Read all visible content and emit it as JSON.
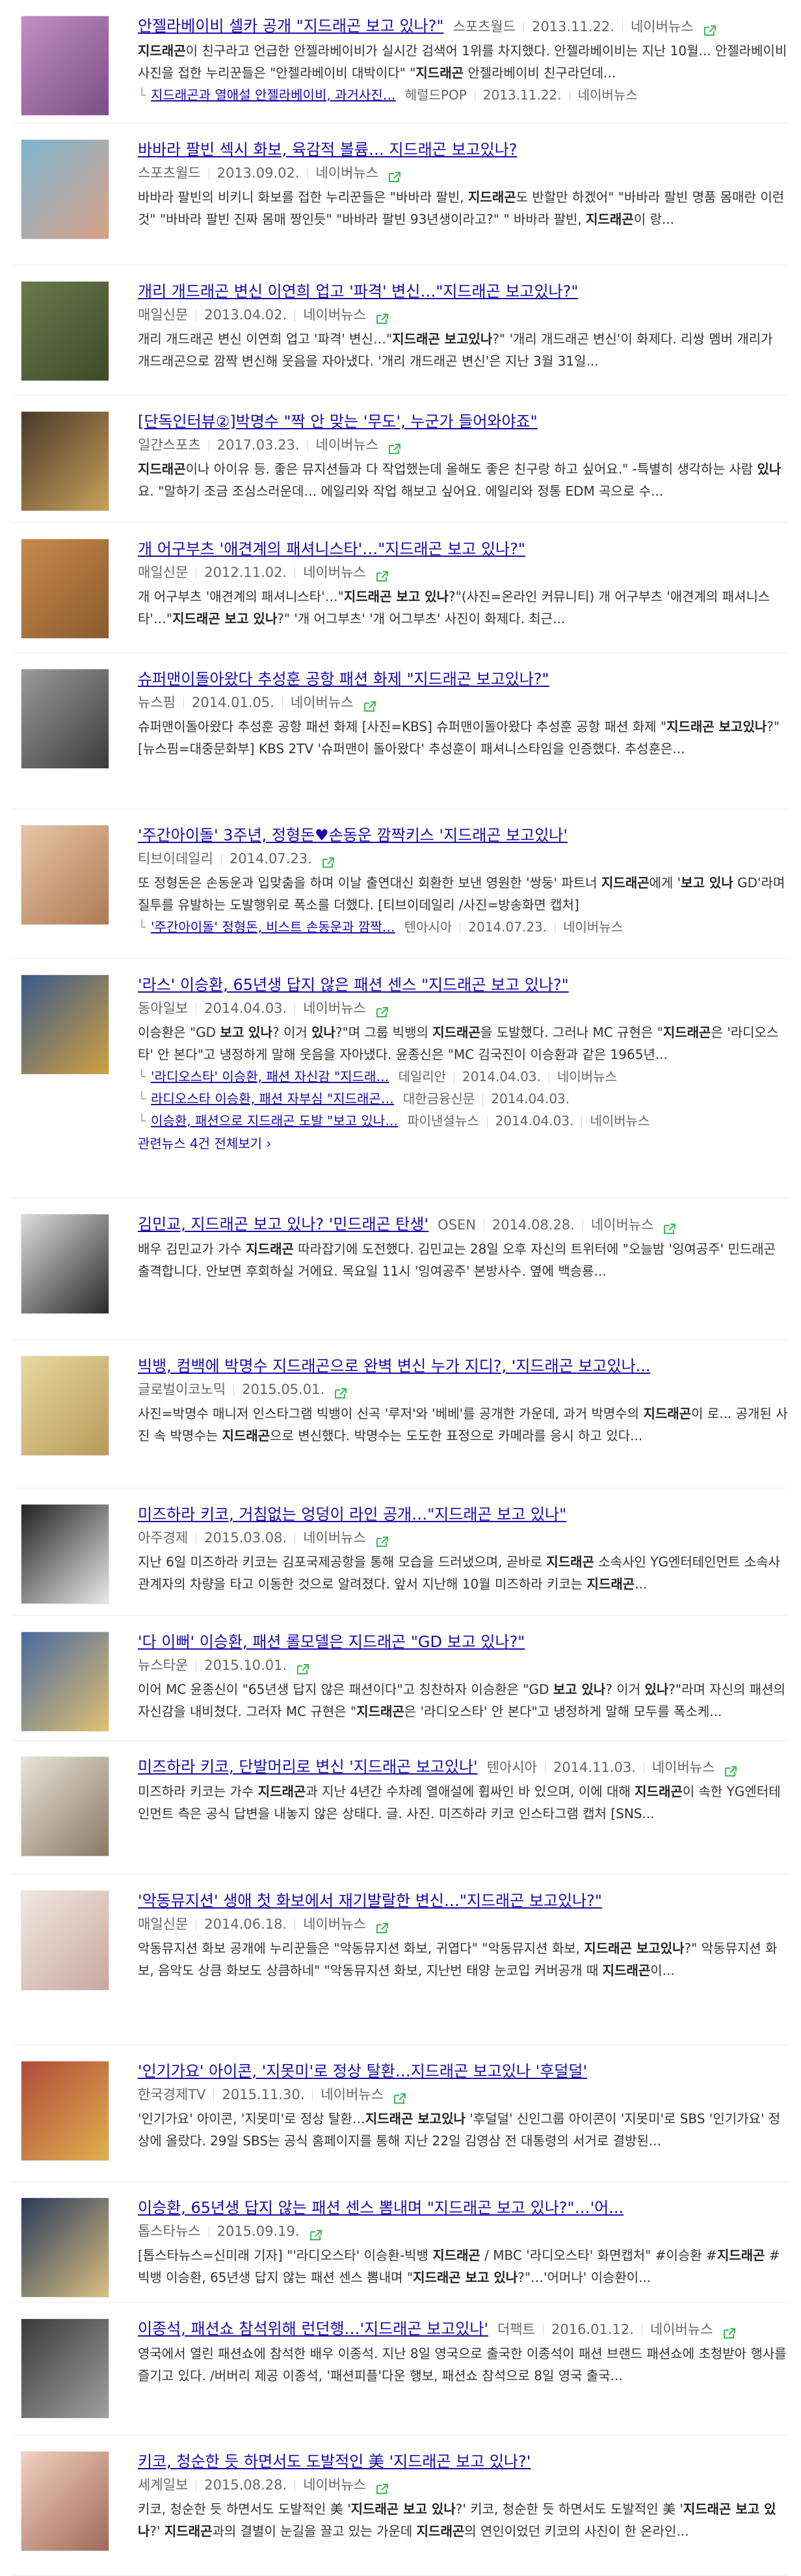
{
  "accent": "#1a0dab",
  "icon": "external-link-icon",
  "items": [
    {
      "title": "안젤라베이비 셀카 공개 \"지드래곤 보고 있나?\"",
      "source": "스포츠월드",
      "date": "2013.11.22.",
      "portal": "네이버뉴스",
      "snippet": "지드래곤이 친구라고 언급한 안젤라베이비가 실시간 검색어 1위를 차지했다. 안젤라베이비는 지난 10월... 안젤라베이비 사진을 접한 누리꾼들은 \"안젤라베이비 대박이다\" \"지드래곤 안젤라베이비 친구라던데...",
      "related": [
        {
          "title": "지드래곤과 열애설 안젤라베이비, 과거사진…",
          "source": "헤럴드POP",
          "date": "2013.11.22.",
          "portal": "네이버뉴스"
        }
      ],
      "thumb": [
        "#c28fc4",
        "#7c4d86"
      ]
    },
    {
      "title": "바바라 팔빈 섹시 화보, 육감적 볼륨… 지드래곤 보고있나?",
      "source": "스포츠월드",
      "date": "2013.09.02.",
      "portal": "네이버뉴스",
      "snippet": "바바라 팔빈의 비키니 화보를 접한 누리꾼들은 \"바바라 팔빈, 지드래곤도 반할만 하겠어\" \"바바라 팔빈 명품 몸매란 이런 것\" \"바바라 팔빈 진짜 몸매 짱인듯\" \"바바라 팔빈 93년생이라고?\" \" 바바라 팔빈, 지드래곤이 랑...",
      "related": [],
      "thumb": [
        "#7fb6d2",
        "#d9a087"
      ]
    },
    {
      "title": "개리 개드래곤 변신 이연희 업고 '파격' 변신…\"지드래곤 보고있나?\"",
      "source": "매일신문",
      "date": "2013.04.02.",
      "portal": "네이버뉴스",
      "snippet": "개리 개드래곤 변신 이연희 업고 '파격' 변신…\"지드래곤 보고있나?\" '개리 개드래곤 변신'이 화제다. 리쌍 멤버 개리가 개드래곤으로 깜짝 변신해 웃음을 자아냈다. '개리 개드래곤 변신'은 지난 3월 31일...",
      "related": [],
      "thumb": [
        "#6b7a4a",
        "#3d4a2c"
      ]
    },
    {
      "title": "[단독인터뷰②]박명수 \"짝 안 맞는 '무도', 누군가 들어와야죠\"",
      "source": "일간스포츠",
      "date": "2017.03.23.",
      "portal": "네이버뉴스",
      "snippet": "지드래곤이나 아이유 등. 좋은 뮤지션들과 다 작업했는데 올해도 좋은 친구랑 하고 싶어요.\" -특별히 생각하는 사람 있나요. \"말하기 조금 조심스러운데… 에일리와 작업 해보고 싶어요. 에일리와 정통 EDM 곡으로 수...",
      "related": [],
      "thumb": [
        "#4a3a2a",
        "#c9a15a"
      ]
    },
    {
      "title": "개 어구부츠 '애견계의 패셔니스타'…\"지드래곤 보고 있나?\"",
      "source": "매일신문",
      "date": "2012.11.02.",
      "portal": "네이버뉴스",
      "snippet": "개 어구부츠 '애견계의 패셔니스타'…\"지드래곤 보고 있나?\"(사진=온라인 커뮤니티) 개 어구부츠 '애견계의 패셔니스타'…\"지드래곤 보고 있나?\" '개 어그부츠' '개 어그부츠' 사진이 화제다. 최근...",
      "related": [],
      "thumb": [
        "#c98a4b",
        "#8a5a2e"
      ]
    },
    {
      "title": "슈퍼맨이돌아왔다 추성훈 공항 패션 화제 \"지드래곤 보고있나?\"",
      "source": "뉴스핌",
      "date": "2014.01.05.",
      "portal": "네이버뉴스",
      "snippet": "슈퍼맨이돌아왔다 추성훈 공항 패션 화제 [사진=KBS] 슈퍼맨이돌아왔다 추성훈 공항 패션 화제 \"지드래곤 보고있나?\" [뉴스핌=대중문화부] KBS 2TV '슈퍼맨이 돌아왔다' 추성훈이 패셔니스타임을 인증했다. 추성훈은...",
      "related": [],
      "thumb": [
        "#9a9a9a",
        "#3c3c3c"
      ]
    },
    {
      "title": "'주간아이돌' 3주년, 정형돈♥손동운 깜짝키스 '지드래곤 보고있나'",
      "source": "티브이데일리",
      "date": "2014.07.23.",
      "portal": "",
      "snippet": "또 정형돈은 손동운과 입맞춤을 하며 이날 출연대신 회환한 보낸 영원한 '쌍둥' 파트너 지드래곤에게 '보고 있나 GD'라며 질투를 유발하는 도발행위로 폭소를 더했다. [티브이데일리 /사진=방송화면 캡처]",
      "related": [
        {
          "title": "'주간아이돌' 정형돈, 비스트 손동운과 깜짝…",
          "source": "텐아시아",
          "date": "2014.07.23.",
          "portal": "네이버뉴스"
        }
      ],
      "thumb": [
        "#e7c6a6",
        "#b07a55"
      ]
    },
    {
      "title": "'라스' 이승환, 65년생 답지 않은 패션 센스 \"지드래곤 보고 있나?\"",
      "source": "동아일보",
      "date": "2014.04.03.",
      "portal": "네이버뉴스",
      "snippet": "이승환은 \"GD 보고 있나? 이거 있나?\"며 그룹 빅뱅의 지드래곤을 도발했다. 그러나 MC 규현은 \"지드래곤은 '라디오스타' 안 본다\"고 냉정하게 말해 웃음을 자아냈다. 윤종신은 \"MC 김국진이 이승환과 같은 1965년...",
      "related": [
        {
          "title": "'라디오스타' 이승환, 패션 자신감 \"지드래…",
          "source": "데일리안",
          "date": "2014.04.03.",
          "portal": "네이버뉴스"
        },
        {
          "title": "라디오스타 이승환, 패션 자부심 \"지드래곤…",
          "source": "대한금융신문",
          "date": "2014.04.03.",
          "portal": ""
        },
        {
          "title": "이승환, 패션으로 지드래곤 도발 \"보고 있나…",
          "source": "파이낸셜뉴스",
          "date": "2014.04.03.",
          "portal": "네이버뉴스"
        }
      ],
      "more": "관련뉴스 4건 전체보기",
      "thumb": [
        "#3a5a8a",
        "#d0a040"
      ]
    },
    {
      "title": "김민교, 지드래곤 보고 있나? '민드래곤 탄생'",
      "source": "OSEN",
      "date": "2014.08.28.",
      "portal": "네이버뉴스",
      "snippet": "배우 김민교가 가수 지드래곤 따라잡기에 도전했다. 김민교는 28일 오후 자신의 트위터에 \"오늘밤 '잉여공주' 민드래곤 출격합니다. 안보면 후회하실 거에요. 목요일 11시 '잉여공주' 본방사수. 옆에 백승룡...",
      "related": [],
      "thumb": [
        "#dcdcdc",
        "#2a2a2a"
      ]
    },
    {
      "title": "빅뱅, 컴백에 박명수 지드래곤으로 완벽 변신 누가 지디?, '지드래곤 보고있나...",
      "source": "글로벌이코노믹",
      "date": "2015.05.01.",
      "portal": "",
      "snippet": "사진=박명수 매니저 인스타그램 빅뱅이 신곡 '루저'와 '베베'를 공개한 가운데, 과거 박명수의 지드래곤이 로... 공개된 사진 속 박명수는 지드래곤으로 변신했다. 박명수는 도도한 표정으로 카메라를 응시 하고 있다...",
      "related": [],
      "thumb": [
        "#e8d9a0",
        "#b89a5a"
      ]
    },
    {
      "title": "미즈하라 키코, 거침없는 엉덩이 라인 공개…\"지드래곤 보고 있나\"",
      "source": "아주경제",
      "date": "2015.03.08.",
      "portal": "네이버뉴스",
      "snippet": "지난 6일 미즈하라 키코는 김포국제공항을 통해 모습을 드러냈으며, 곧바로 지드래곤 소속사인 YG엔터테인먼트 소속사 관계자의 차량을 타고 이동한 것으로 알려졌다. 앞서 지난해 10월 미즈하라 키코는 지드래곤...",
      "related": [],
      "thumb": [
        "#222222",
        "#e9e9e9"
      ]
    },
    {
      "title": "'다 이뻐' 이승환, 패션 롤모델은 지드래곤 \"GD 보고 있나?\"",
      "source": "뉴스타운",
      "date": "2015.10.01.",
      "portal": "",
      "snippet": "이어 MC 윤종신이 \"65년생 답지 않은 패션이다\"고 칭찬하자 이승환은 \"GD 보고 있나? 이거 있나?\"라며 자신의 패션의 자신감을 내비쳤다. 그러자 MC 규현은 \"지드래곤은 '라디오스타' 안 본다\"고 냉정하게 말해 모두를 폭소케...",
      "related": [],
      "thumb": [
        "#4a6aa0",
        "#e0c070"
      ]
    },
    {
      "title": "미즈하라 키코, 단발머리로 변신 '지드래곤 보고있나'",
      "source": "텐아시아",
      "date": "2014.11.03.",
      "portal": "네이버뉴스",
      "snippet": "미즈하라 키코는 가수 지드래곤과 지난 4년간 수차례 열애설에 휩싸인 바 있으며, 이에 대해 지드래곤이 속한 YG엔터테인먼트 측은 공식 답변을 내놓지 않은 상태다. 글. 사진. 미즈하라 키코 인스타그램 캡처 [SNS...",
      "related": [],
      "thumb": [
        "#e9e2d6",
        "#8a7a66"
      ]
    },
    {
      "title": "'악동뮤지션' 생애 첫 화보에서 재기발랄한 변신…\"지드래곤 보고있나?\"",
      "source": "매일신문",
      "date": "2014.06.18.",
      "portal": "네이버뉴스",
      "snippet": "악동뮤지션 화보 공개에 누리꾼들은 \"악동뮤지션 화보, 귀엽다\" \"악동뮤지션 화보, 지드래곤 보고있나?\" 악동뮤지션 화보, 음악도 상큼 화보도 상큼하네\" \"악동뮤지션 화보, 지난번 태양 눈코입 커버공개 때 지드래곤이...",
      "related": [],
      "thumb": [
        "#f0e8e0",
        "#c8a8a0"
      ]
    },
    {
      "title": "'인기가요' 아이콘, '지못미'로 정상 탈환…지드래곤 보고있나 '후덜덜'",
      "source": "한국경제TV",
      "date": "2015.11.30.",
      "portal": "네이버뉴스",
      "snippet": "'인기가요' 아이콘, '지못미'로 정상 탈환…지드래곤 보고있나 '후덜덜' 신인그룹 아이콘이 '지못미'로 SBS '인기가요' 정상에 올랐다. 29일 SBS는 공식 홈페이지를 통해 지난 22일 김영삼 전 대통령의 서거로 결방된...",
      "related": [],
      "thumb": [
        "#b04a3a",
        "#e0b050"
      ]
    },
    {
      "title": "이승환, 65년생 답지 않는 패션 센스 뽐내며 \"지드래곤 보고 있나?\"…'어...",
      "source": "톱스타뉴스",
      "date": "2015.09.19.",
      "portal": "",
      "snippet": "[톱스타뉴스=신미래 기자] \"'라디오스타' 이승환-빅뱅 지드래곤 / MBC '라디오스타' 화면캡처\" #이승환 #지드래곤 #빅뱅 이승환, 65년생 답지 않는 패션 센스 뽐내며 \"지드래곤 보고 있나?\"…'어머나' 이승환이...",
      "related": [],
      "thumb": [
        "#2a3a5a",
        "#d8c080"
      ]
    },
    {
      "title": "이종석, 패션쇼 참석위해 런던행…'지드래곤 보고있나'",
      "source": "더팩트",
      "date": "2016.01.12.",
      "portal": "네이버뉴스",
      "snippet": "영국에서 열린 패션쇼에 참석한 배우 이종석. 지난 8일 영국으로 출국한 이종석이 패션 브랜드 패션쇼에 초청받아 행사를 즐기고 있다. /버버리 제공 이종석, '패션피플'다운 행보, 패션쇼 참석으로 8일 영국 출국...",
      "related": [],
      "thumb": [
        "#3a3a3a",
        "#a0a0a0"
      ]
    },
    {
      "title": "키코, 청순한 듯 하면서도 도발적인 美 '지드래곤 보고 있나?'",
      "source": "세계일보",
      "date": "2015.08.28.",
      "portal": "네이버뉴스",
      "snippet": "키코, 청순한 듯 하면서도 도발적인 美 '지드래곤 보고 있나?' 키코, 청순한 듯 하면서도 도발적인 美 '지드래곤 보고 있나?' 지드래곤과의 결별이 눈길을 끌고 있는 가운데 지드래곤의 연인이었던 키코의 사진이 한 온라인...",
      "related": [],
      "thumb": [
        "#f2d0c0",
        "#a06a5a"
      ]
    }
  ]
}
